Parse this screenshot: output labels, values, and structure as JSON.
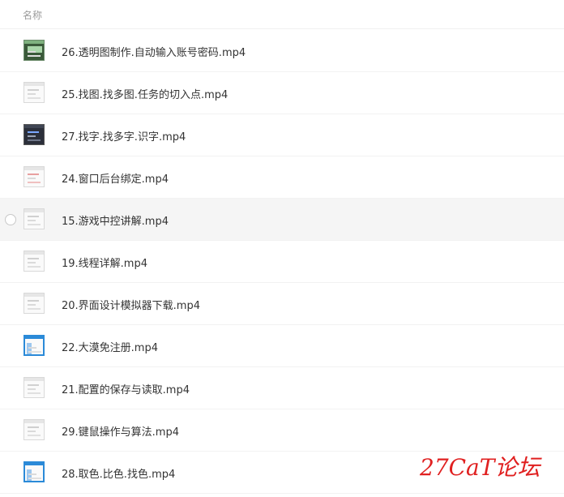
{
  "header": {
    "column_name": "名称"
  },
  "files": [
    {
      "name": "26.透明图制作.自动输入账号密码.mp4",
      "thumb": "green"
    },
    {
      "name": "25.找图.找多图.任务的切入点.mp4",
      "thumb": "plain"
    },
    {
      "name": "27.找字.找多字.识字.mp4",
      "thumb": "dark"
    },
    {
      "name": "24.窗口后台绑定.mp4",
      "thumb": "red"
    },
    {
      "name": "15.游戏中控讲解.mp4",
      "thumb": "plain"
    },
    {
      "name": "19.线程详解.mp4",
      "thumb": "plain"
    },
    {
      "name": "20.界面设计模拟器下载.mp4",
      "thumb": "plain"
    },
    {
      "name": "22.大漠免注册.mp4",
      "thumb": "blue"
    },
    {
      "name": "21.配置的保存与读取.mp4",
      "thumb": "plain"
    },
    {
      "name": "29.键鼠操作与算法.mp4",
      "thumb": "plain"
    },
    {
      "name": "28.取色.比色.找色.mp4",
      "thumb": "blue"
    }
  ],
  "watermark": "27CaT论坛"
}
